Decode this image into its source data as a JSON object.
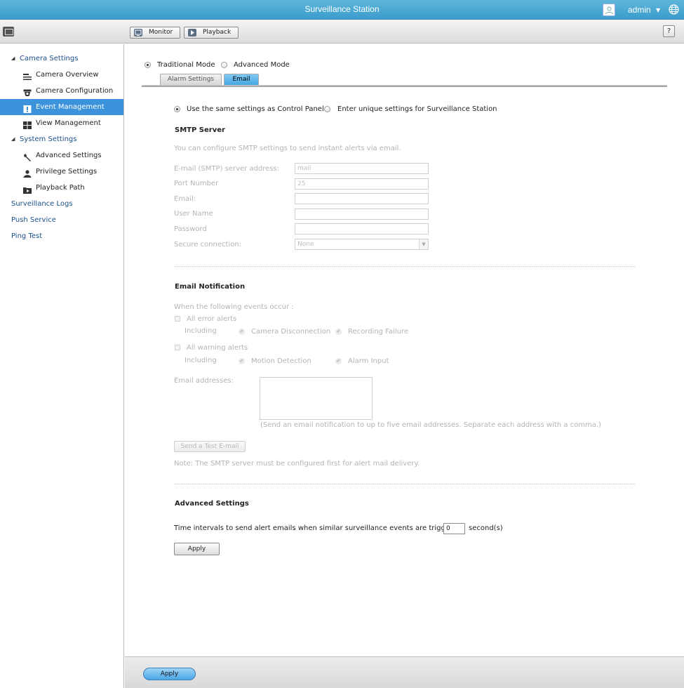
{
  "window": {
    "title": "Surveillance Station",
    "user": "admin"
  },
  "toolbar": {
    "monitor_label": "Monitor",
    "playback_label": "Playback",
    "help_label": "?"
  },
  "sidebar": {
    "camera_settings": "Camera Settings",
    "camera_overview": "Camera Overview",
    "camera_configuration": "Camera Configuration",
    "event_management": "Event Management",
    "view_management": "View Management",
    "system_settings": "System Settings",
    "advanced_settings": "Advanced Settings",
    "privilege_settings": "Privilege Settings",
    "playback_path": "Playback Path",
    "surveillance_logs": "Surveillance Logs",
    "push_service": "Push Service",
    "ping_test": "Ping Test",
    "active_item": "Event Management"
  },
  "mode": {
    "traditional": "Traditional Mode",
    "advanced": "Advanced Mode",
    "selected": "Traditional Mode"
  },
  "tabs": {
    "alarm_settings": "Alarm Settings",
    "email": "Email",
    "active": "Email"
  },
  "source": {
    "same_as_control_panel": "Use the same settings as Control Panel",
    "unique": "Enter unique settings for Surveillance Station",
    "selected": "Use the same settings as Control Panel"
  },
  "smtp": {
    "heading": "SMTP Server",
    "description": "You can configure SMTP settings to send instant alerts via email.",
    "server_label": "E-mail (SMTP) server address:",
    "server_value": "mail",
    "port_label": "Port Number",
    "port_value": "25",
    "email_label": "Email:",
    "email_value": "",
    "username_label": "User Name",
    "username_value": "",
    "password_label": "Password",
    "password_value": "",
    "secure_label": "Secure connection:",
    "secure_value": "None"
  },
  "notification": {
    "heading": "Email Notification",
    "events_intro": "When the following events occur :",
    "all_error_alerts": "All error alerts",
    "including": "Including",
    "camera_disconnection": "Camera Disconnection",
    "recording_failure": "Recording Failure",
    "all_warning_alerts": "All warning alerts",
    "motion_detection": "Motion Detection",
    "alarm_input": "Alarm Input",
    "addresses_label": "Email addresses:",
    "addresses_value": "",
    "addresses_hint": "(Send an email notification to up to five email addresses. Separate each address with a comma.)",
    "test_button": "Send a Test E-mail",
    "note": "Note: The SMTP server must be configured first for alert mail delivery."
  },
  "advanced": {
    "heading": "Advanced Settings",
    "interval_label": "Time intervals to send alert emails when similar surveillance events are triggered:",
    "interval_value": "0",
    "interval_unit": "second(s)",
    "apply_label": "Apply"
  },
  "footer": {
    "apply_label": "Apply"
  }
}
